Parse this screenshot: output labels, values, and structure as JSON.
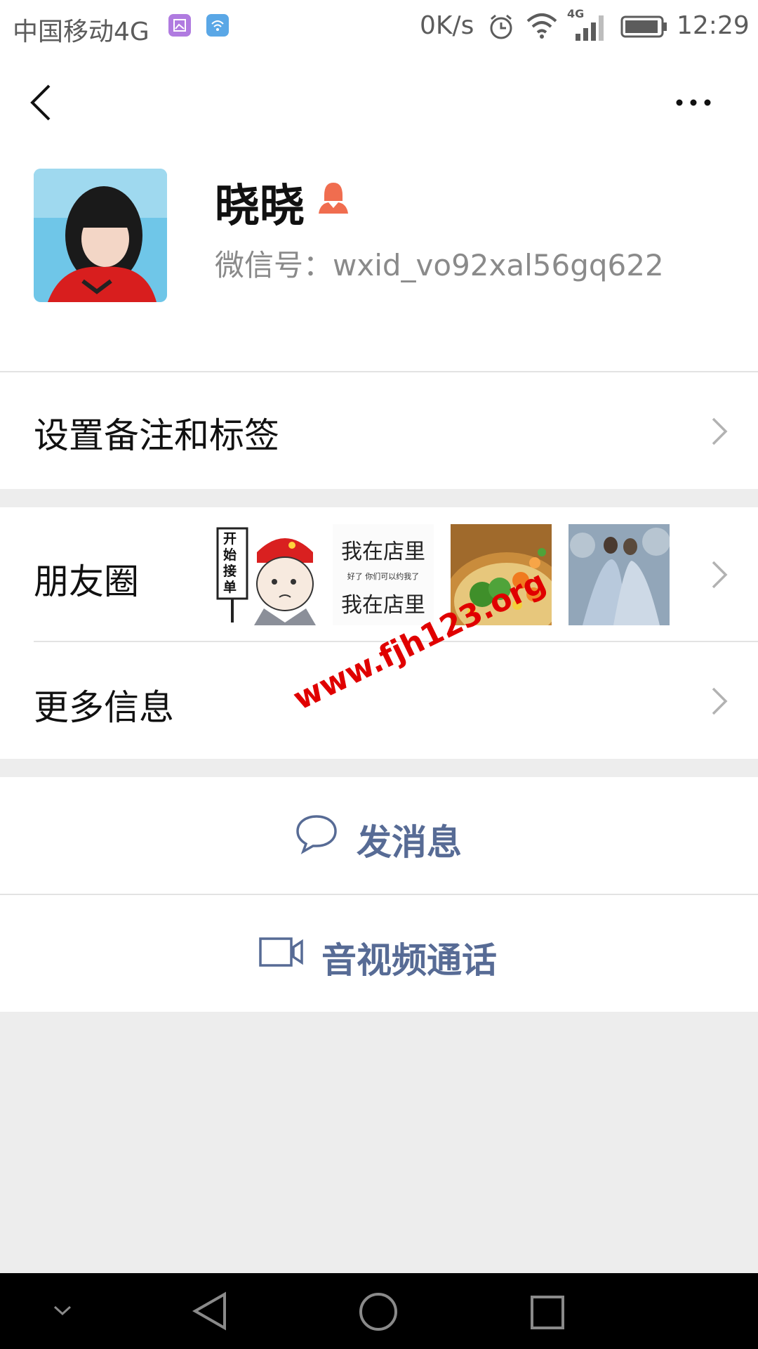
{
  "status_bar": {
    "carrier": "中国移动4G",
    "speed": "0K/s",
    "network_badge": "4G",
    "time": "12:29"
  },
  "top_bar": {
    "back_icon": "chevron-left-icon",
    "more_icon": "more-horizontal-icon"
  },
  "profile": {
    "name": "晓晓",
    "gender_icon": "female-user-icon",
    "wechat_id": "微信号：wxid_vo92xal56gq622"
  },
  "rows": {
    "remark_label": "设置备注和标签",
    "moments_label": "朋友圈",
    "more_info_label": "更多信息"
  },
  "moments_thumbs": {
    "thumb1_text": "开始接单",
    "thumb2_line1": "我在店里",
    "thumb2_line2": "好了 你们可以约我了",
    "thumb2_line3": "我在店里"
  },
  "actions": {
    "message_label": "发消息",
    "call_label": "音视频通话"
  },
  "watermark": "www.fjh123.org",
  "colors": {
    "link_blue": "#576b95",
    "background_gray": "#ededed",
    "gender_orange": "#f06d4f",
    "watermark_red": "#e00000"
  }
}
